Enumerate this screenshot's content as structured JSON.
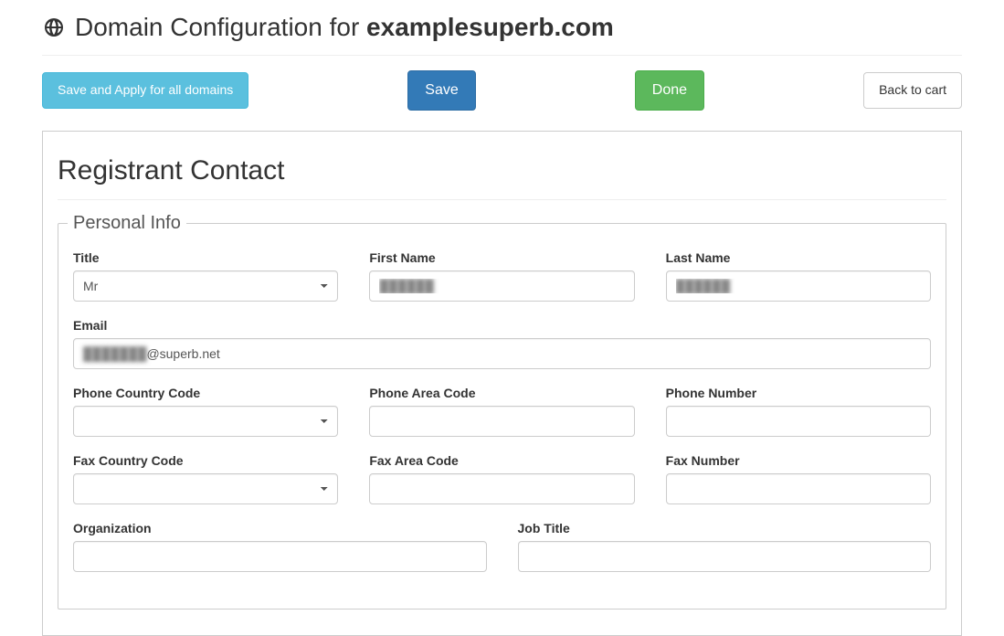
{
  "header": {
    "title_prefix": "Domain Configuration for ",
    "domain": "examplesuperb.com"
  },
  "toolbar": {
    "save_all_label": "Save and Apply for all domains",
    "save_label": "Save",
    "done_label": "Done",
    "back_label": "Back to cart"
  },
  "panel": {
    "title": "Registrant Contact",
    "fieldset_legend": "Personal Info"
  },
  "fields": {
    "title": {
      "label": "Title",
      "value": "Mr"
    },
    "first_name": {
      "label": "First Name",
      "value": "██████"
    },
    "last_name": {
      "label": "Last Name",
      "value": "██████"
    },
    "email": {
      "label": "Email",
      "local": "███████",
      "domain": "@superb.net"
    },
    "phone_cc": {
      "label": "Phone Country Code",
      "value": ""
    },
    "phone_area": {
      "label": "Phone Area Code",
      "value": ""
    },
    "phone_num": {
      "label": "Phone Number",
      "value": ""
    },
    "fax_cc": {
      "label": "Fax Country Code",
      "value": ""
    },
    "fax_area": {
      "label": "Fax Area Code",
      "value": ""
    },
    "fax_num": {
      "label": "Fax Number",
      "value": ""
    },
    "org": {
      "label": "Organization",
      "value": ""
    },
    "job": {
      "label": "Job Title",
      "value": ""
    }
  }
}
